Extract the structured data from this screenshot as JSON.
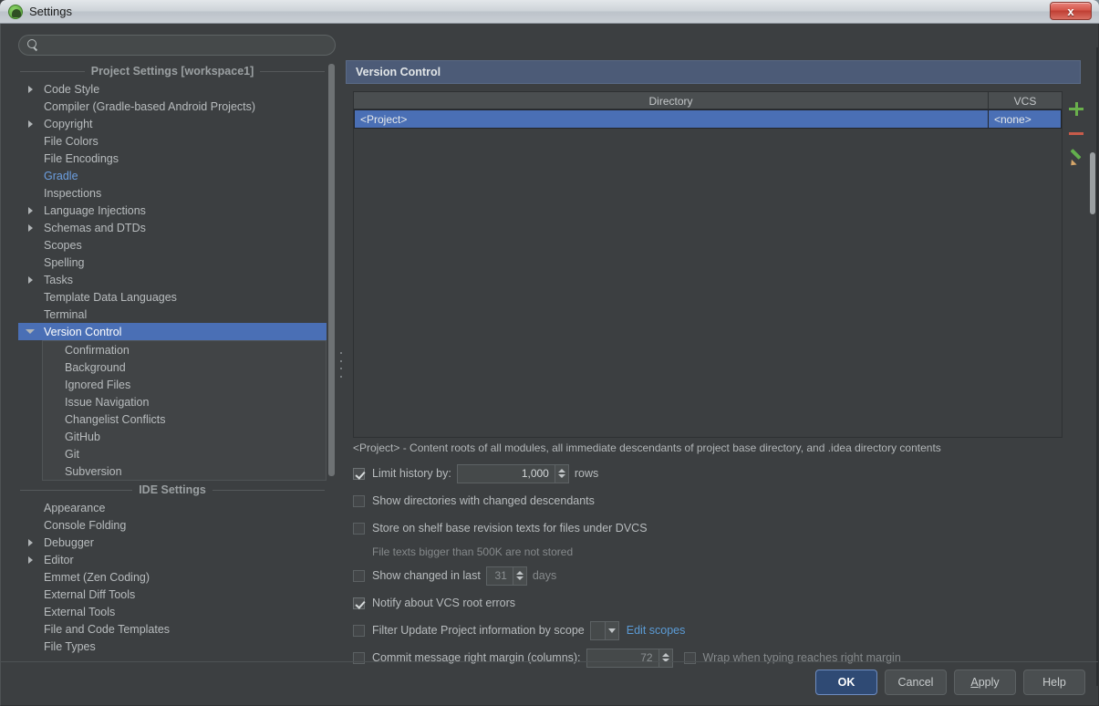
{
  "window": {
    "title": "Settings",
    "app_icon": "android-studio-icon",
    "close_label": "x"
  },
  "sidebar": {
    "search": {
      "value": "",
      "placeholder": "",
      "icon": "search-icon"
    },
    "groups": [
      {
        "label": "Project Settings [workspace1]",
        "items": [
          {
            "label": "Code Style",
            "arrow": "right",
            "style": "normal"
          },
          {
            "label": "Compiler (Gradle-based Android Projects)",
            "arrow": "none",
            "style": "normal"
          },
          {
            "label": "Copyright",
            "arrow": "right",
            "style": "normal"
          },
          {
            "label": "File Colors",
            "arrow": "none",
            "style": "normal"
          },
          {
            "label": "File Encodings",
            "arrow": "none",
            "style": "normal"
          },
          {
            "label": "Gradle",
            "arrow": "none",
            "style": "link"
          },
          {
            "label": "Inspections",
            "arrow": "none",
            "style": "normal"
          },
          {
            "label": "Language Injections",
            "arrow": "right",
            "style": "normal"
          },
          {
            "label": "Schemas and DTDs",
            "arrow": "right",
            "style": "normal"
          },
          {
            "label": "Scopes",
            "arrow": "none",
            "style": "normal"
          },
          {
            "label": "Spelling",
            "arrow": "none",
            "style": "normal"
          },
          {
            "label": "Tasks",
            "arrow": "right",
            "style": "normal"
          },
          {
            "label": "Template Data Languages",
            "arrow": "none",
            "style": "normal"
          },
          {
            "label": "Terminal",
            "arrow": "none",
            "style": "normal"
          },
          {
            "label": "Version Control",
            "arrow": "down",
            "style": "selected"
          }
        ],
        "children": [
          {
            "label": "Confirmation"
          },
          {
            "label": "Background"
          },
          {
            "label": "Ignored Files"
          },
          {
            "label": "Issue Navigation"
          },
          {
            "label": "Changelist Conflicts"
          },
          {
            "label": "GitHub"
          },
          {
            "label": "Git"
          },
          {
            "label": "Subversion"
          }
        ]
      },
      {
        "label": "IDE Settings",
        "items": [
          {
            "label": "Appearance",
            "arrow": "none",
            "style": "normal"
          },
          {
            "label": "Console Folding",
            "arrow": "none",
            "style": "normal"
          },
          {
            "label": "Debugger",
            "arrow": "right",
            "style": "normal"
          },
          {
            "label": "Editor",
            "arrow": "right",
            "style": "normal"
          },
          {
            "label": "Emmet (Zen Coding)",
            "arrow": "none",
            "style": "normal"
          },
          {
            "label": "External Diff Tools",
            "arrow": "none",
            "style": "normal"
          },
          {
            "label": "External Tools",
            "arrow": "none",
            "style": "normal"
          },
          {
            "label": "File and Code Templates",
            "arrow": "none",
            "style": "normal"
          },
          {
            "label": "File Types",
            "arrow": "none",
            "style": "normal"
          }
        ],
        "children": []
      }
    ]
  },
  "panel": {
    "title": "Version Control",
    "table": {
      "columns": [
        "Directory",
        "VCS"
      ],
      "rows": [
        {
          "directory": "<Project>",
          "vcs": "<none>",
          "selected": true
        }
      ]
    },
    "tools": [
      {
        "name": "add-directory-button",
        "icon": "plus-icon"
      },
      {
        "name": "remove-directory-button",
        "icon": "minus-icon"
      },
      {
        "name": "edit-directory-button",
        "icon": "pencil-icon"
      }
    ],
    "note": "<Project> - Content roots of all modules, all immediate descendants of project base directory, and .idea directory contents",
    "options": {
      "limit_history": {
        "label": "Limit history by:",
        "checked": true,
        "value": "1,000",
        "suffix": "rows"
      },
      "show_dirs_changed_descendants": {
        "label": "Show directories with changed descendants",
        "checked": false
      },
      "store_shelf_base_revision": {
        "label": "Store on shelf base revision texts for files under DVCS",
        "checked": false,
        "note": "File texts bigger than 500K are not stored"
      },
      "show_changed_in_last": {
        "label_before": "Show changed in last",
        "checked": false,
        "value": "31",
        "label_after": "days"
      },
      "notify_vcs_root_errors": {
        "label": "Notify about VCS root errors",
        "checked": true
      },
      "filter_update_by_scope": {
        "label": "Filter Update Project information by scope",
        "checked": false,
        "scope_value": "",
        "link": "Edit scopes"
      },
      "commit_right_margin": {
        "label": "Commit message right margin (columns):",
        "checked": false,
        "value": "72",
        "wrap_label": "Wrap when typing reaches right margin",
        "wrap_checked": false
      }
    }
  },
  "footer": {
    "buttons": [
      {
        "label": "OK",
        "primary": true
      },
      {
        "label": "Cancel",
        "primary": false
      },
      {
        "label": "Apply",
        "primary": false
      },
      {
        "label": "Help",
        "primary": false
      }
    ]
  },
  "colors": {
    "accent_selection": "#4a6fb5",
    "panel_header": "#4c5b77",
    "link": "#5b9bd5",
    "window_bg": "#3c3f41",
    "plus_green": "#6ab04c",
    "minus_red": "#c75b4a"
  }
}
